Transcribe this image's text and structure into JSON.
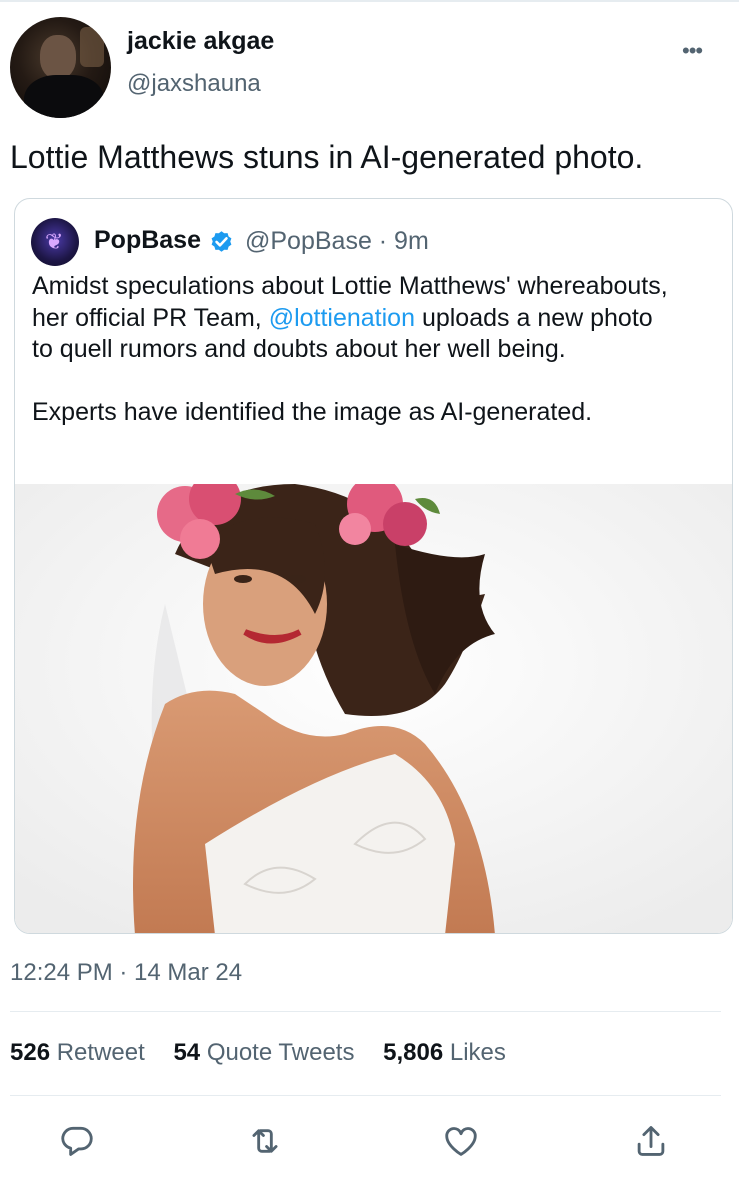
{
  "user": {
    "name": "jackie akgae",
    "handle": "@jaxshauna"
  },
  "more_label": "•••",
  "tweet": {
    "text": "Lottie Matthews stuns in AI-generated photo."
  },
  "quoted": {
    "name": "PopBase",
    "handle_time": "@PopBase · 9m",
    "body_before": "Amidst speculations about Lottie Matthews' whereabouts, her official PR Team, ",
    "mention": "@lottienation",
    "body_after": " uploads a new photo to quell rumors and doubts about her well being.",
    "body2": "Experts have identified the image as AI-generated."
  },
  "meta": {
    "timestamp": "12:24 PM · 14 Mar 24"
  },
  "stats": [
    {
      "count": "526",
      "label": "Retweet"
    },
    {
      "count": "54",
      "label": "Quote Tweets"
    },
    {
      "count": "5,806",
      "label": "Likes"
    }
  ],
  "actions": [
    "reply-icon",
    "retweet-icon",
    "like-icon",
    "share-icon"
  ],
  "colors": {
    "link": "#1d9bf0",
    "secondary_text": "#536471",
    "border": "#cfd9de",
    "verified": "#1d9bf0"
  }
}
